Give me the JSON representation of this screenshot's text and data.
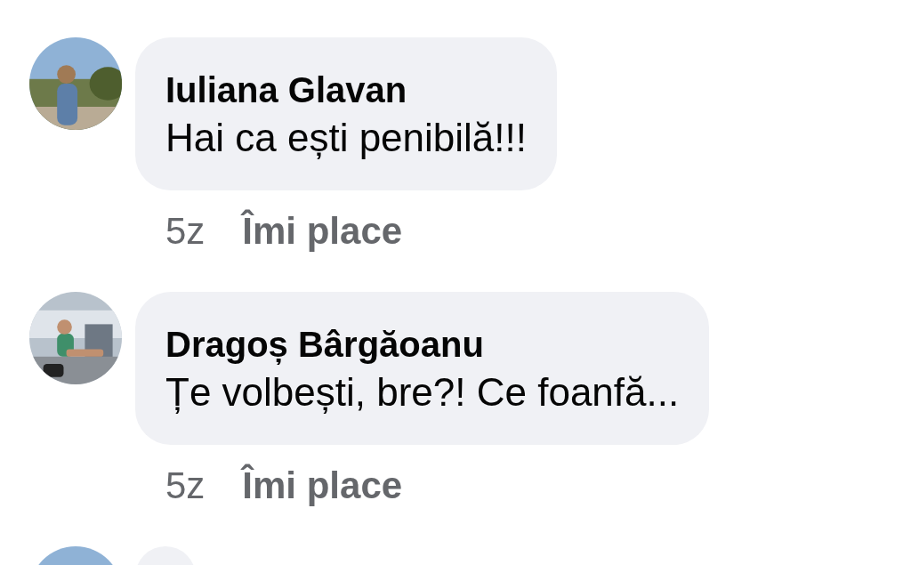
{
  "comments": [
    {
      "avatar": {
        "kind": "picture"
      },
      "name": "Iuliana Glavan",
      "text": "Hai ca ești penibilă!!!",
      "time": "5z",
      "like": "Îmi place"
    },
    {
      "avatar": {
        "kind": "picture"
      },
      "name": "Dragoș Bârgăoanu",
      "text": "Țe volbești, bre?! Ce foanfă...",
      "time": "5z",
      "like": "Îmi place"
    },
    {
      "avatar": {
        "kind": "picture"
      }
    }
  ]
}
